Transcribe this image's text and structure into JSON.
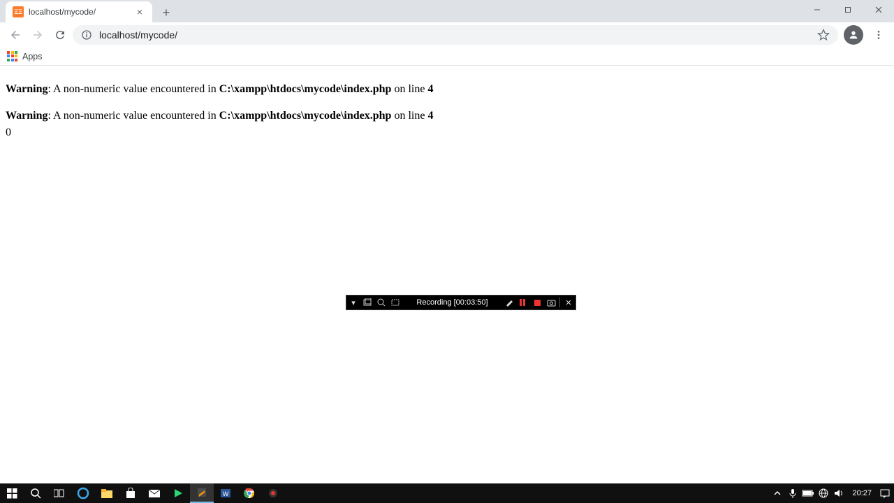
{
  "tab": {
    "title": "localhost/mycode/"
  },
  "url": "localhost/mycode/",
  "bookmarks": {
    "apps_label": "Apps"
  },
  "warnings": [
    {
      "label": "Warning",
      "msg": ": A non-numeric value encountered in ",
      "file": "C:\\xampp\\htdocs\\mycode\\index.php",
      "on_line": " on line ",
      "line": "4"
    },
    {
      "label": "Warning",
      "msg": ": A non-numeric value encountered in ",
      "file": "C:\\xampp\\htdocs\\mycode\\index.php",
      "on_line": " on line ",
      "line": "4"
    }
  ],
  "output": "0",
  "recorder": {
    "status": "Recording [00:03:50]"
  },
  "taskbar": {
    "clock": "20:27"
  }
}
